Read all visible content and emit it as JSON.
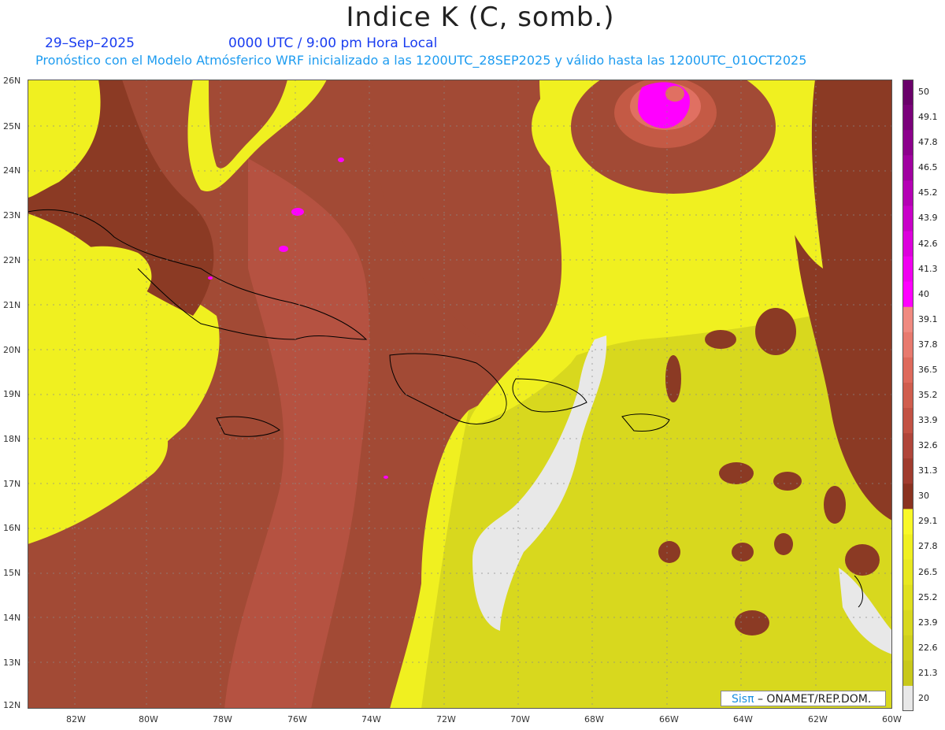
{
  "header": {
    "title": "Indice K (C, somb.)",
    "date": "29–Sep–2025",
    "time": "0000 UTC / 9:00 pm Hora Local",
    "subtitle": "Pronóstico con el Modelo Atmósferico WRF inicializado a las 1200UTC_28SEP2025 y válido hasta las  1200UTC_01OCT2025"
  },
  "map": {
    "lat_labels": [
      "26N",
      "25N",
      "24N",
      "23N",
      "22N",
      "21N",
      "20N",
      "19N",
      "18N",
      "17N",
      "16N",
      "15N",
      "14N",
      "13N",
      "12N"
    ],
    "lon_labels": [
      "82W",
      "80W",
      "78W",
      "76W",
      "74W",
      "72W",
      "70W",
      "68W",
      "66W",
      "64W",
      "62W",
      "60W"
    ],
    "lat_range": [
      12,
      26
    ],
    "lon_range": [
      -83.2,
      -60
    ],
    "grid": true,
    "colors": {
      "sea_low": "#f0f020",
      "dark_brown": "#8b3a24",
      "mid_brown": "#a24a35",
      "salmon": "#c45a45",
      "light_salmon": "#e07062",
      "magenta": "#ff00ff",
      "dry_gray": "#e8e8e8",
      "olive": "#d4d41e"
    }
  },
  "colorbar": {
    "labels": [
      "50",
      "49.1",
      "47.8",
      "46.5",
      "45.2",
      "43.9",
      "42.6",
      "41.3",
      "40",
      "39.1",
      "37.8",
      "36.5",
      "35.2",
      "33.9",
      "32.6",
      "31.3",
      "30",
      "29.1",
      "27.8",
      "26.5",
      "25.2",
      "23.9",
      "22.6",
      "21.3",
      "20"
    ],
    "colors": [
      "#6a006a",
      "#7a007a",
      "#8c008c",
      "#a000a0",
      "#b400b4",
      "#c800c8",
      "#dc00dc",
      "#f000f0",
      "#ff00ff",
      "#f08a80",
      "#e87a6e",
      "#de6a5c",
      "#d05e4e",
      "#c25244",
      "#b0463a",
      "#a03c2e",
      "#8a3220",
      "#f8f828",
      "#f0f020",
      "#e8e820",
      "#e0e01e",
      "#d8d81e",
      "#d0d01c",
      "#c8c81a",
      "#e8e8e8"
    ]
  },
  "credit": {
    "sis": "Sisπ",
    "text": "– ONAMET/REP.DOM."
  }
}
